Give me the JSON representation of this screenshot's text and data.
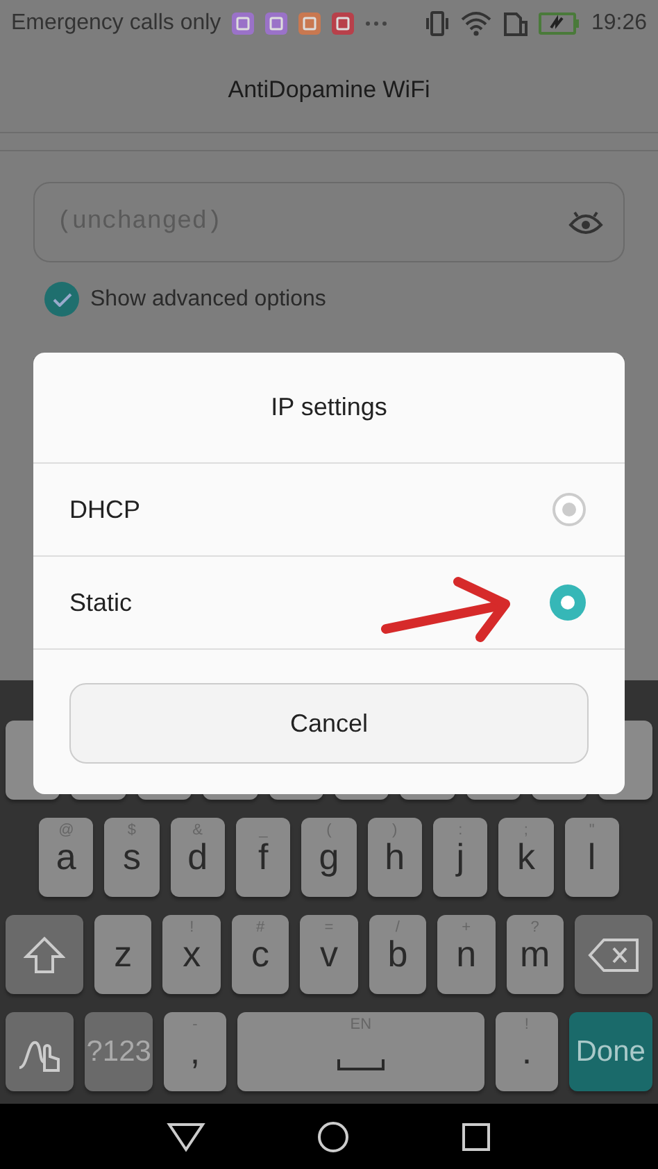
{
  "status_bar": {
    "carrier": "Emergency calls only",
    "time": "19:26"
  },
  "title": "AntiDopamine WiFi",
  "password_field": {
    "placeholder": "(unchanged)"
  },
  "advanced_checkbox": {
    "label": "Show advanced options",
    "checked": true
  },
  "dialog": {
    "title": "IP settings",
    "options": [
      {
        "label": "DHCP",
        "selected": false
      },
      {
        "label": "Static",
        "selected": true
      }
    ],
    "cancel_button": "Cancel"
  },
  "keyboard": {
    "rows": [
      {
        "keys": [
          {
            "kind": "blank"
          },
          {
            "kind": "blank"
          },
          {
            "kind": "blank"
          },
          {
            "kind": "blank"
          },
          {
            "kind": "blank"
          },
          {
            "kind": "blank"
          },
          {
            "kind": "blank"
          },
          {
            "kind": "blank"
          },
          {
            "kind": "blank"
          },
          {
            "kind": "blank"
          }
        ]
      },
      {
        "keys": [
          {
            "kind": "letter",
            "label": "a",
            "hint": "@"
          },
          {
            "kind": "letter",
            "label": "s",
            "hint": "$"
          },
          {
            "kind": "letter",
            "label": "d",
            "hint": "&"
          },
          {
            "kind": "letter",
            "label": "f",
            "hint": "_"
          },
          {
            "kind": "letter",
            "label": "g",
            "hint": "("
          },
          {
            "kind": "letter",
            "label": "h",
            "hint": ")"
          },
          {
            "kind": "letter",
            "label": "j",
            "hint": ":"
          },
          {
            "kind": "letter",
            "label": "k",
            "hint": ";"
          },
          {
            "kind": "letter",
            "label": "l",
            "hint": "\""
          }
        ]
      },
      {
        "keys": [
          {
            "kind": "shift"
          },
          {
            "kind": "letter",
            "label": "z"
          },
          {
            "kind": "letter",
            "label": "x",
            "hint": "!"
          },
          {
            "kind": "letter",
            "label": "c",
            "hint": "#"
          },
          {
            "kind": "letter",
            "label": "v",
            "hint": "="
          },
          {
            "kind": "letter",
            "label": "b",
            "hint": "/"
          },
          {
            "kind": "letter",
            "label": "n",
            "hint": "+"
          },
          {
            "kind": "letter",
            "label": "m",
            "hint": "?"
          },
          {
            "kind": "backspace"
          }
        ]
      },
      {
        "keys": [
          {
            "kind": "gesture"
          },
          {
            "kind": "symbols",
            "label": "?123"
          },
          {
            "kind": "letter",
            "label": ",",
            "hint": "-"
          },
          {
            "kind": "space",
            "hint": "EN"
          },
          {
            "kind": "letter",
            "label": ".",
            "hint": "!"
          },
          {
            "kind": "done",
            "label": "Done"
          }
        ]
      }
    ]
  }
}
